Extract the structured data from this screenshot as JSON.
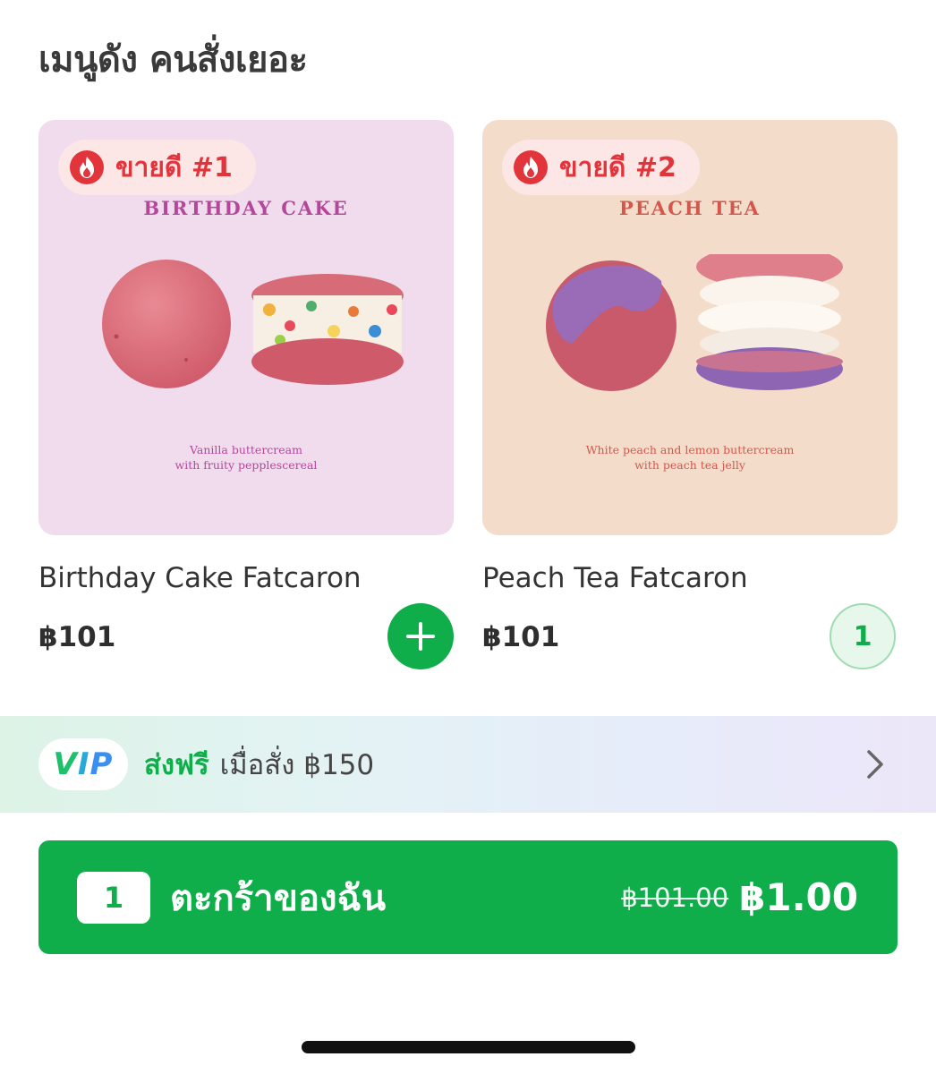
{
  "section_title": "เมนูดัง คนสั่งเยอะ",
  "products": [
    {
      "badge": "ขายดี #1",
      "art_title": "BIRTHDAY CAKE",
      "art_desc_line1": "Vanilla buttercream",
      "art_desc_line2": "with fruity pepplescereal",
      "name": "Birthday Cake Fatcaron",
      "price": "฿101",
      "action_icon": "plus-icon"
    },
    {
      "badge": "ขายดี #2",
      "art_title": "PEACH TEA",
      "art_desc_line1": "White peach and lemon buttercream",
      "art_desc_line2": "with peach tea jelly",
      "name": "Peach Tea Fatcaron",
      "price": "฿101",
      "quantity": "1"
    }
  ],
  "vip_banner": {
    "logo_v": "V",
    "logo_i": "I",
    "logo_p": "P",
    "free_text": "ส่งฟรี",
    "condition_text": "เมื่อสั่ง ฿150",
    "icon": "chevron-right-icon"
  },
  "cart": {
    "count": "1",
    "label": "ตะกร้าของฉัน",
    "original_price": "฿101.00",
    "price": "฿1.00"
  },
  "colors": {
    "brand_green": "#0fae4a",
    "badge_red": "#e2343b",
    "badge_bg": "#fde6e6"
  }
}
